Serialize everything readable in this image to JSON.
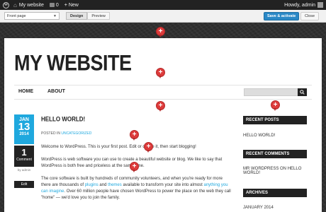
{
  "adminbar": {
    "site_name": "My website",
    "comment_count": "0",
    "new_label": "New",
    "howdy": "Howdy, admin"
  },
  "toolbar": {
    "page_select_value": "Front page",
    "design_label": "Design",
    "preview_label": "Preview",
    "save_label": "Save & activate",
    "close_label": "Close"
  },
  "site": {
    "title": "MY WEBSITE",
    "nav": [
      "HOME",
      "ABOUT"
    ]
  },
  "post": {
    "month": "JAN",
    "day": "13",
    "year": "2014",
    "comment_count": "1",
    "comment_label": "Comment",
    "author": "by admin",
    "edit_label": "Edit",
    "title": "HELLO WORLD!",
    "posted_in": "POSTED IN",
    "category": "UNCATEGORIZED",
    "p1": "Welcome to WordPress. This is your first post. Edit or delete it, then start blogging!",
    "p2": "WordPress is web software you can use to create a beautiful website or blog. We like to say that WordPress is both free and priceless at the same time.",
    "p3_a": "The core software is built by hundreds of community volunteers, and when you're ready for more there are thousands of ",
    "p3_link1": "plugins",
    "p3_b": " and ",
    "p3_link2": "themes",
    "p3_c": " available to transform your site into almost ",
    "p3_link3": "anything you can imagine",
    "p3_d": ". Over 60 million people have chosen WordPress to power the place on the web they call \"home\" — we'd love you to join the family."
  },
  "sidebar": {
    "recent_posts_heading": "RECENT POSTS",
    "recent_post_1": "HELLO WORLD!",
    "recent_comments_heading": "RECENT COMMENTS",
    "comment_author": "MR WORDPRESS",
    "comment_on": " ON ",
    "comment_post": "HELLO WORLD!",
    "archives_heading": "ARCHIVES",
    "archive_1": "JANUARY 2014"
  },
  "colors": {
    "accent": "#1fa8de",
    "marker": "#dd3b3b",
    "primary_button": "#2a88c6"
  },
  "icons": [
    "wordpress-logo-icon",
    "home-icon",
    "comment-bubble-icon",
    "plus-icon",
    "search-icon",
    "edit-marker-icon",
    "chevron-down-icon"
  ]
}
